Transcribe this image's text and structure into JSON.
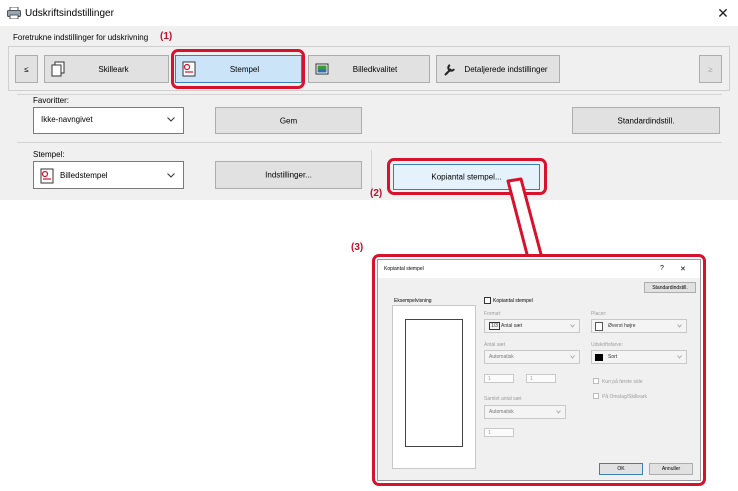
{
  "window": {
    "title": "Udskriftsindstillinger",
    "close_glyph": "✕",
    "icon": "printer-icon"
  },
  "tabs_label": "Foretrukne indstillinger for udskrivning",
  "tabs": {
    "prev": "≤",
    "next": "≥",
    "items": [
      {
        "label": "Skilleark",
        "icon": "pages-icon"
      },
      {
        "label": "Stempel",
        "icon": "stamp-icon"
      },
      {
        "label": "Billedkvalitet",
        "icon": "image-quality-icon"
      },
      {
        "label": "Detaljerede indstillinger",
        "icon": "wrench-icon"
      }
    ]
  },
  "favorites": {
    "label": "Favoritter:",
    "value": "Ikke-navngivet",
    "save_label": "Gem",
    "default_label": "Standardindstill."
  },
  "stamp": {
    "label": "Stempel:",
    "value": "Billedstempel",
    "settings_label": "Indstillinger...",
    "copy_stamp_label": "Kopiantal stempel..."
  },
  "callouts": {
    "c1": "(1)",
    "c2": "(2)",
    "c3": "(3)"
  },
  "accent_color": "#d8112d",
  "popup": {
    "title": "Kopiantal stempel",
    "help_glyph": "?",
    "close_glyph": "✕",
    "default_label": "Standardindstill.",
    "preview_label": "Eksempelvisning",
    "checkbox_label": "Kopiantal stempel",
    "format": {
      "label": "Format:",
      "value": "Antal sæt",
      "prefix": "1/3"
    },
    "position": {
      "label": "Placer:",
      "value": "Øverst højre"
    },
    "sets": {
      "label": "Antal sæt",
      "value": "Automatisk",
      "field1": "1",
      "field2": "1"
    },
    "print_color": {
      "label": "Udskriftsfarve:",
      "value": "Sort"
    },
    "first_page_only": "Kun på første side",
    "on_cover": "På Omslag/Skilleark",
    "total_sets": {
      "label": "Samlet antal sæt",
      "value": "Automatisk",
      "field": "1"
    },
    "ok_label": "OK",
    "cancel_label": "Annuller"
  }
}
